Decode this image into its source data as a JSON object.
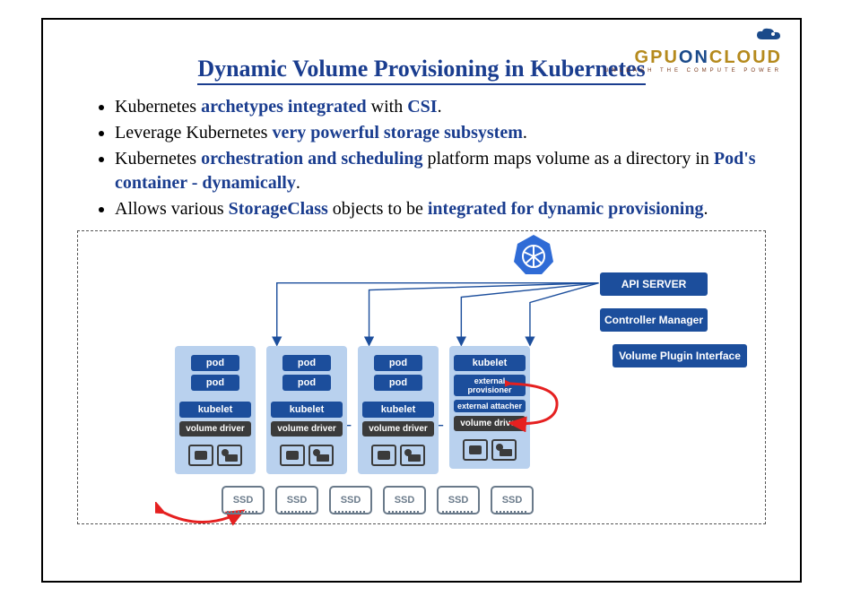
{
  "logo": {
    "main_a": "GPU",
    "main_o": "ON",
    "main_b": "CLOUD",
    "sub": "UNLEASH THE COMPUTE POWER"
  },
  "title": "Dynamic Volume Provisioning in Kubernetes",
  "bullets": [
    {
      "pre": "Kubernetes ",
      "em1": "archetypes integrated",
      "mid": " with ",
      "em2": "CSI",
      "post": "."
    },
    {
      "pre": "Leverage Kubernetes ",
      "em1": "very powerful storage subsystem",
      "mid": "",
      "em2": "",
      "post": "."
    },
    {
      "pre": "Kubernetes ",
      "em1": "orchestration and scheduling",
      "mid": " platform maps volume as a directory in ",
      "em2": "Pod's container - dynamically",
      "post": "."
    },
    {
      "pre": "Allows various ",
      "em1": "StorageClass",
      "mid": " objects to be ",
      "em2": "integrated for dynamic provisioning",
      "post": "."
    }
  ],
  "control_plane": {
    "api": "API SERVER",
    "controller": "Controller Manager",
    "vpi": "Volume Plugin Interface"
  },
  "node_labels": {
    "pod": "pod",
    "kubelet": "kubelet",
    "volume_driver": "volume driver",
    "ext_provisioner": "external provisioner",
    "ext_attacher": "external attacher"
  },
  "storage_label": "SSD",
  "counts": {
    "worker_nodes": 3,
    "ssd_count": 6
  }
}
